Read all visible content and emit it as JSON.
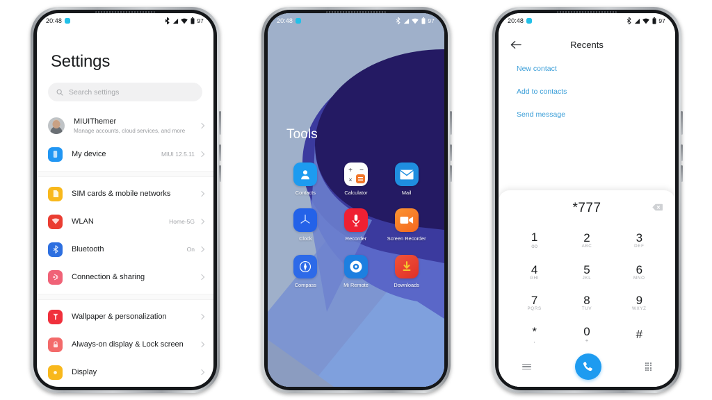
{
  "statusbar": {
    "time": "20:48",
    "battery_percent": "97",
    "icons": [
      "bluetooth-icon",
      "signal-icon",
      "wifi-icon",
      "battery-icon"
    ]
  },
  "phone1": {
    "title": "Settings",
    "search": {
      "placeholder": "Search settings",
      "icon": "search-icon"
    },
    "account": {
      "name": "MIUIThemer",
      "subtitle": "Manage accounts, cloud services, and more"
    },
    "groups": [
      {
        "items": [
          {
            "label": "My device",
            "value": "MIUI 12.5.11",
            "icon": "device-icon",
            "color": "#2196f3"
          }
        ]
      },
      {
        "items": [
          {
            "label": "SIM cards & mobile networks",
            "value": "",
            "icon": "sim-icon",
            "color": "#f8b81c"
          },
          {
            "label": "WLAN",
            "value": "Home-5G",
            "icon": "wifi-icon",
            "color": "#ea3d32"
          },
          {
            "label": "Bluetooth",
            "value": "On",
            "icon": "bluetooth-icon",
            "color": "#2d6fe0"
          },
          {
            "label": "Connection & sharing",
            "value": "",
            "icon": "connection-icon",
            "color": "#f06277"
          }
        ]
      },
      {
        "items": [
          {
            "label": "Wallpaper & personalization",
            "value": "",
            "icon": "wallpaper-icon",
            "color": "#f0303c"
          },
          {
            "label": "Always-on display & Lock screen",
            "value": "",
            "icon": "lock-icon",
            "color": "#f36a6a"
          },
          {
            "label": "Display",
            "value": "",
            "icon": "display-icon",
            "color": "#f8b81c"
          }
        ]
      }
    ]
  },
  "phone2": {
    "folder_title": "Tools",
    "apps": [
      {
        "name": "Contacts",
        "icon": "contacts-icon"
      },
      {
        "name": "Calculator",
        "icon": "calculator-icon"
      },
      {
        "name": "Mail",
        "icon": "mail-icon"
      },
      {
        "name": "Clock",
        "icon": "clock-icon"
      },
      {
        "name": "Recorder",
        "icon": "microphone-icon"
      },
      {
        "name": "Screen Recorder",
        "icon": "video-camera-icon"
      },
      {
        "name": "Compass",
        "icon": "compass-icon"
      },
      {
        "name": "Mi Remote",
        "icon": "remote-icon"
      },
      {
        "name": "Downloads",
        "icon": "download-icon"
      }
    ],
    "wallpaper_colors": {
      "background": "#9fb0ca",
      "dark": "#241a63",
      "mid": "#5a67c8",
      "light": "#7d95d1"
    }
  },
  "phone3": {
    "title": "Recents",
    "back_icon": "arrow-left-icon",
    "links": [
      "New contact",
      "Add to contacts",
      "Send message"
    ],
    "link_color": "#3a9ed8",
    "dialer": {
      "number": "*777",
      "delete_icon": "backspace-icon",
      "keys": [
        {
          "digit": "1",
          "sub": "oo",
          "sym": true
        },
        {
          "digit": "2",
          "sub": "ABC",
          "sym": false
        },
        {
          "digit": "3",
          "sub": "DEF",
          "sym": false
        },
        {
          "digit": "4",
          "sub": "GHI",
          "sym": false
        },
        {
          "digit": "5",
          "sub": "JKL",
          "sym": false
        },
        {
          "digit": "6",
          "sub": "MNO",
          "sym": false
        },
        {
          "digit": "7",
          "sub": "PQRS",
          "sym": false
        },
        {
          "digit": "8",
          "sub": "TUV",
          "sym": false
        },
        {
          "digit": "9",
          "sub": "WXYZ",
          "sym": false
        },
        {
          "digit": "*",
          "sub": ",",
          "sym": true
        },
        {
          "digit": "0",
          "sub": "+",
          "sym": true
        },
        {
          "digit": "#",
          "sub": "",
          "sym": true
        }
      ],
      "menu_icon": "menu-icon",
      "call_icon": "phone-call-icon",
      "call_color": "#1d9bf0",
      "keypad_icon": "keypad-grid-icon"
    }
  }
}
